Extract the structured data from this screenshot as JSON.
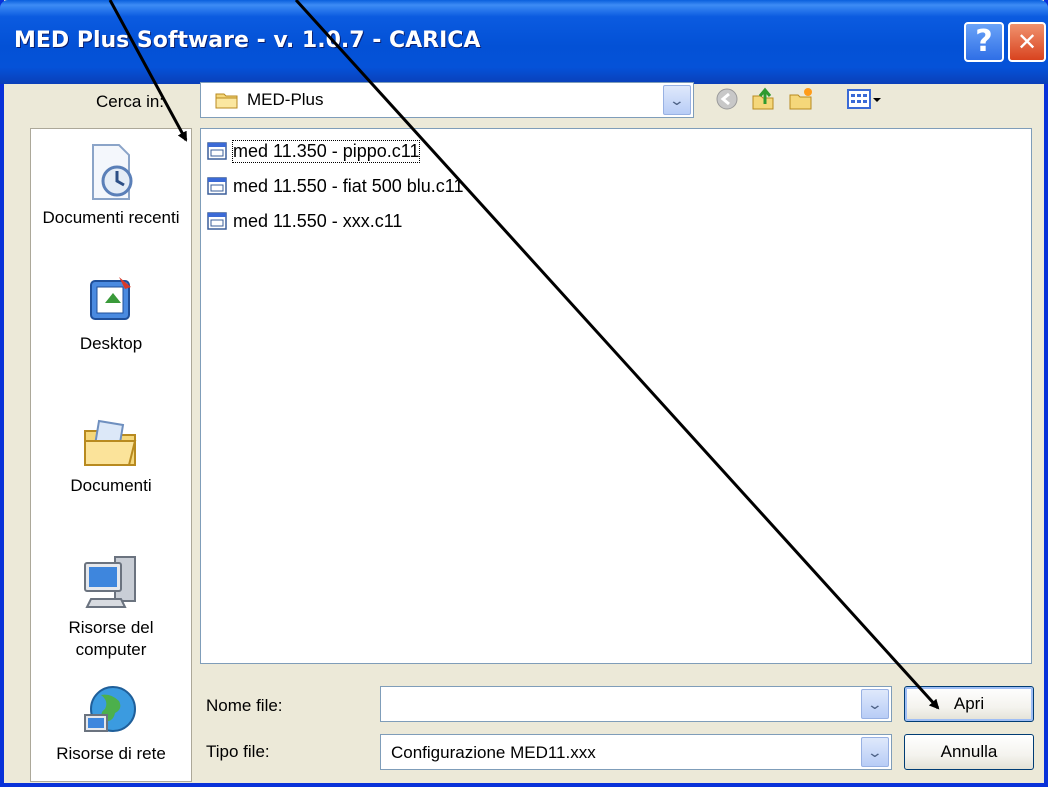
{
  "window": {
    "title": "MED Plus Software - v. 1.0.7 - CARICA",
    "help_glyph": "?",
    "close_glyph": "✕"
  },
  "lookin": {
    "label": "Cerca in:",
    "value": "MED-Plus"
  },
  "toolbar_icons": [
    "back-icon",
    "up-folder-icon",
    "new-folder-icon",
    "view-menu-icon"
  ],
  "places": [
    {
      "label": "Documenti recenti",
      "icon": "recent-documents-icon"
    },
    {
      "label": "Desktop",
      "icon": "desktop-icon"
    },
    {
      "label": "Documenti",
      "icon": "my-documents-icon"
    },
    {
      "label": "Risorse del computer",
      "icon": "my-computer-icon"
    },
    {
      "label": "Risorse di rete",
      "icon": "network-places-icon"
    }
  ],
  "files": [
    {
      "name": "med 11.350 - pippo.c11"
    },
    {
      "name": "med 11.550 - fiat 500 blu.c11"
    },
    {
      "name": "med 11.550 - xxx.c11"
    }
  ],
  "filename": {
    "label": "Nome file:",
    "value": ""
  },
  "filetype": {
    "label": "Tipo file:",
    "value": "Configurazione MED11.xxx"
  },
  "buttons": {
    "open": "Apri",
    "cancel": "Annulla"
  },
  "colors": {
    "titlebar": "#0351d6",
    "dialog_bg": "#ece9d8",
    "border_blue": "#7f9db9"
  }
}
